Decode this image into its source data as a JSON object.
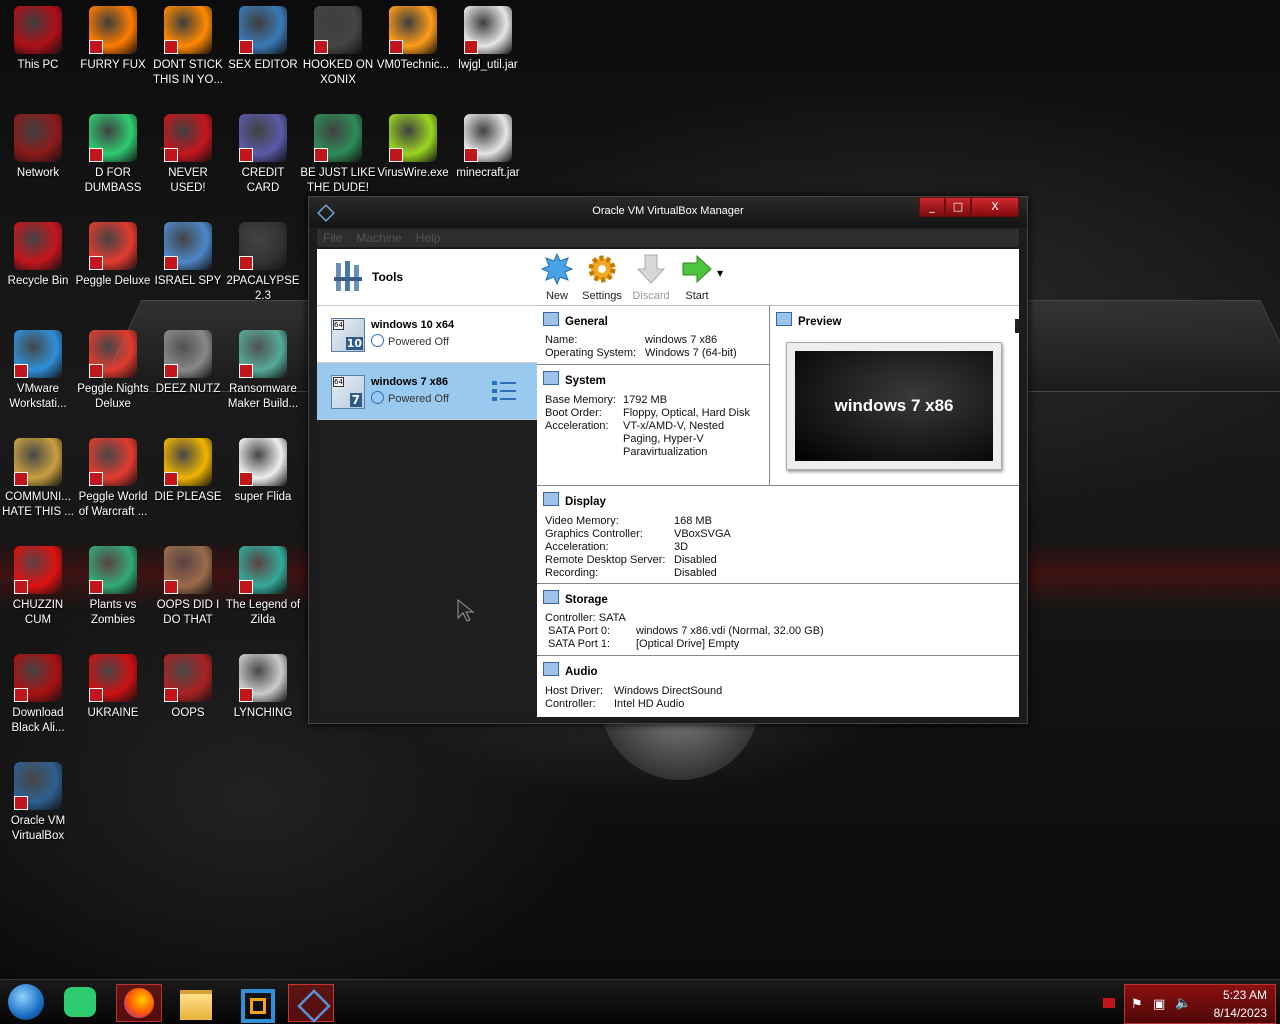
{
  "desktop": {
    "icons": [
      {
        "label": "This PC"
      },
      {
        "label": "FURRY FUX"
      },
      {
        "label": "DONT STICK THIS IN YO..."
      },
      {
        "label": "SEX EDITOR"
      },
      {
        "label": "HOOKED ON XONIX"
      },
      {
        "label": "VM0Technic..."
      },
      {
        "label": "lwjgl_util.jar"
      },
      {
        "label": "Network"
      },
      {
        "label": "D FOR DUMBASS"
      },
      {
        "label": "NEVER USED!"
      },
      {
        "label": "CREDIT CARD CHECKER"
      },
      {
        "label": "BE JUST LIKE THE DUDE!"
      },
      {
        "label": "VirusWire.exe"
      },
      {
        "label": "minecraft.jar"
      },
      {
        "label": "Recycle Bin"
      },
      {
        "label": "Peggle Deluxe"
      },
      {
        "label": "ISRAEL SPY"
      },
      {
        "label": "2PACALYPSE 2.3"
      },
      {
        "label": "VMware Workstati..."
      },
      {
        "label": "Peggle Nights Deluxe"
      },
      {
        "label": "DEEZ NUTZ"
      },
      {
        "label": "Ransomware Maker Build..."
      },
      {
        "label": "COMMUNI... HATE THIS ..."
      },
      {
        "label": "Peggle World of Warcraft ..."
      },
      {
        "label": "DIE PLEASE"
      },
      {
        "label": "super Flida"
      },
      {
        "label": "CHUZZIN CUM"
      },
      {
        "label": "Plants vs Zombies"
      },
      {
        "label": "OOPS DID I DO THAT"
      },
      {
        "label": "The Legend of Zilda"
      },
      {
        "label": "Download Black Ali..."
      },
      {
        "label": "UKRAINE"
      },
      {
        "label": "OOPS"
      },
      {
        "label": "LYNCHING"
      },
      {
        "label": "Oracle VM VirtualBox"
      }
    ],
    "icon_colors": [
      "#b01018",
      "#ff7b00",
      "#ff8a00",
      "#3a7ab8",
      "#444",
      "#ff9c1a",
      "#e5e5e5",
      "#8b1a1a",
      "#2ecc71",
      "#c4161c",
      "#5a5aa8",
      "#2e8b57",
      "#9ad620",
      "#e5e5e5",
      "#c4161c",
      "#e23b2e",
      "#4d87c8",
      "#333",
      "#2f8fd8",
      "#e23b2e",
      "#888",
      "#5a9",
      "#c8a040",
      "#e23b2e",
      "#f0b400",
      "#eee",
      "#d11",
      "#3a7",
      "#9a6b4b",
      "#3a9",
      "#a11",
      "#c11",
      "#a22",
      "#ccc",
      "#2f5f8f"
    ]
  },
  "window": {
    "title": "Oracle VM VirtualBox Manager",
    "min": "_",
    "max": "□",
    "close": "X",
    "menu": [
      "File",
      "Machine",
      "Help"
    ]
  },
  "vbox": {
    "tools_label": "Tools",
    "vms": [
      {
        "name": "windows 10 x64",
        "state": "Powered Off",
        "badge": "10"
      },
      {
        "name": "windows 7 x86",
        "state": "Powered Off",
        "badge": "7"
      }
    ],
    "toolbar": {
      "new": "New",
      "settings": "Settings",
      "discard": "Discard",
      "start": "Start"
    },
    "general": {
      "title": "General",
      "k": "Name:\nOperating System:",
      "v": "windows 7 x86\nWindows 7 (64-bit)"
    },
    "system": {
      "title": "System",
      "k": "Base Memory:\nBoot Order:\nAcceleration:",
      "v": "1792 MB\nFloppy, Optical, Hard Disk\nVT-x/AMD-V, Nested\nPaging, Hyper-V\nParavirtualization"
    },
    "preview": {
      "title": "Preview",
      "screen_text": "windows 7 x86"
    },
    "display": {
      "title": "Display",
      "k": "Video Memory:\nGraphics Controller:\nAcceleration:\nRemote Desktop Server:\nRecording:",
      "v": "168 MB\nVBoxSVGA\n3D\nDisabled\nDisabled"
    },
    "storage": {
      "title": "Storage",
      "controller": "Controller: SATA",
      "k": " SATA Port 0:\n SATA Port 1:",
      "v": "windows 7 x86.vdi (Normal, 32.00 GB)\n[Optical Drive] Empty"
    },
    "audio": {
      "title": "Audio",
      "k": "Host Driver:\nController:",
      "v": "Windows DirectSound\nIntel HD Audio"
    }
  },
  "taskbar": {
    "time": "5:23 AM",
    "date": "8/14/2023"
  }
}
